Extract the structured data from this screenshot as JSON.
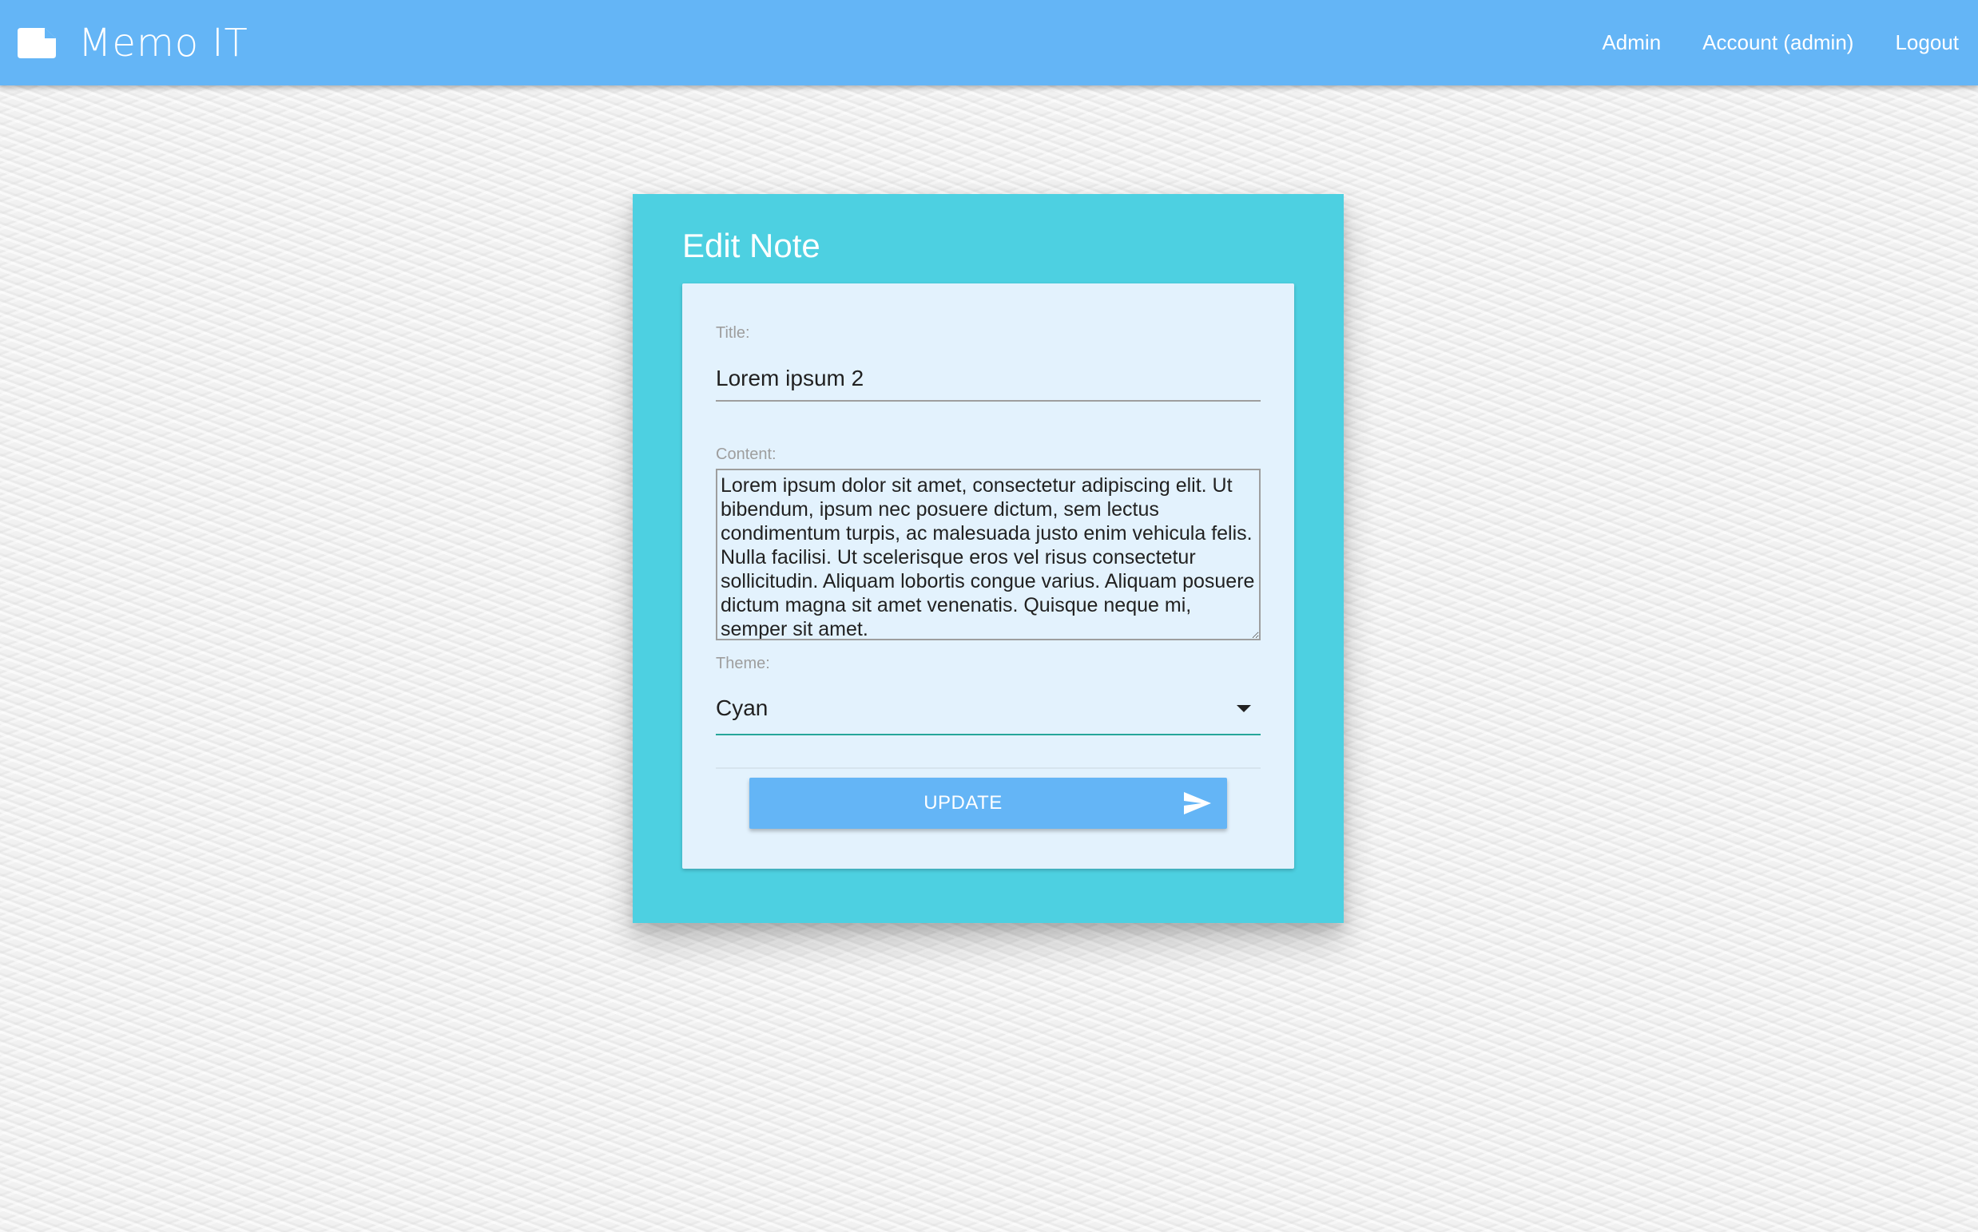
{
  "app": {
    "name": "Memo IT",
    "brand_icon": "note-icon"
  },
  "nav": {
    "links": [
      {
        "label": "Admin"
      },
      {
        "label": "Account (admin)"
      },
      {
        "label": "Logout"
      }
    ]
  },
  "card": {
    "title": "Edit Note",
    "accent_color": "#4dd0e1"
  },
  "form": {
    "title_label": "Title:",
    "title_value": "Lorem ipsum 2",
    "content_label": "Content:",
    "content_value": "Lorem ipsum dolor sit amet, consectetur adipiscing elit. Ut bibendum, ipsum nec posuere dictum, sem lectus condimentum turpis, ac malesuada justo enim vehicula felis. Nulla facilisi. Ut scelerisque eros vel risus consectetur sollicitudin. Aliquam lobortis congue varius. Aliquam posuere dictum magna sit amet venenatis. Quisque neque mi, semper sit amet.",
    "theme_label": "Theme:",
    "theme_value": "Cyan",
    "submit_label": "UPDATE",
    "submit_icon": "send-icon"
  },
  "colors": {
    "navbar": "#64b5f6",
    "button": "#64b5f6",
    "panel": "#e3f2fd",
    "select_underline": "#26a69a"
  }
}
